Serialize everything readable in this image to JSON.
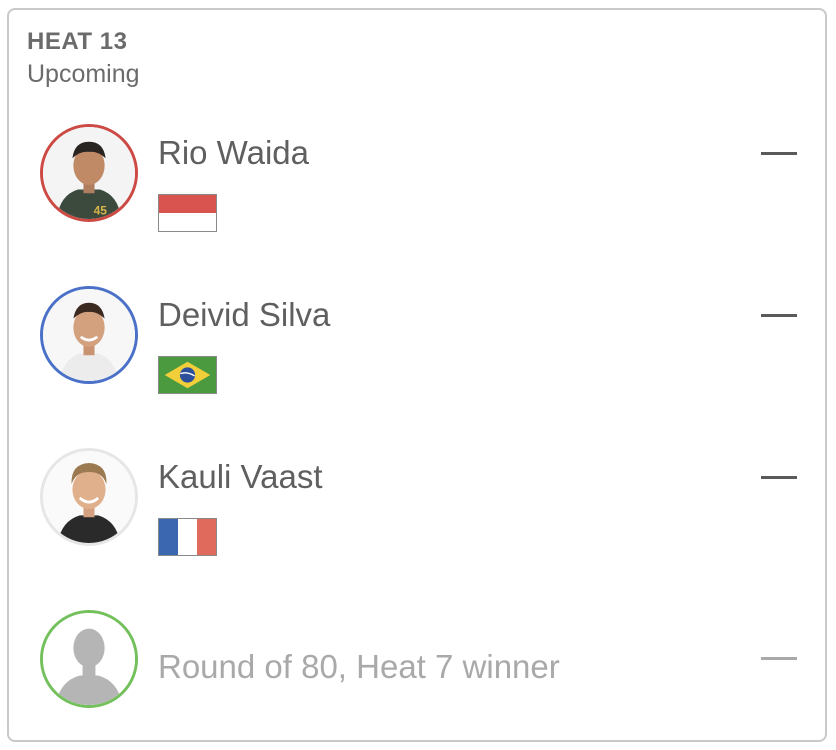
{
  "heat": {
    "title": "HEAT 13",
    "status": "Upcoming"
  },
  "surfers": [
    {
      "name": "Rio Waida",
      "ring_color": "#cc4a43",
      "flag": "indonesia-flag",
      "score": "—"
    },
    {
      "name": "Deivid Silva",
      "ring_color": "#4a70c8",
      "flag": "brazil-flag",
      "score": "—"
    },
    {
      "name": "Kauli Vaast",
      "ring_color": "#e6e6e6",
      "flag": "france-flag",
      "score": "—"
    },
    {
      "name": "Round of 80, Heat 7 winner",
      "ring_color": "#74c05c",
      "flag": "",
      "score": "—"
    }
  ]
}
